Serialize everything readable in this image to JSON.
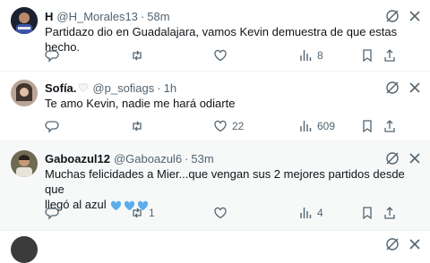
{
  "tweets": [
    {
      "name": "H",
      "handle": "@H_Morales13",
      "time": "58m",
      "text": "Partidazo dio en Guadalajara, vamos Kevin demuestra de que estas hecho.",
      "replies": "",
      "retweets": "",
      "likes": "",
      "views": "8"
    },
    {
      "name": "Sofía.",
      "handle": "@p_sofiags",
      "time": "1h",
      "text": "Te amo Kevin, nadie me hará odiarte",
      "replies": "",
      "retweets": "",
      "likes": "22",
      "views": "609"
    },
    {
      "name": "Gaboazul12",
      "handle": "@Gaboazul6",
      "time": "53m",
      "text_line1": "Muchas felicidades a Mier...que vengan sus 2 mejores partidos desde que",
      "text_line2": "llegó al azul",
      "replies": "",
      "retweets": "1",
      "likes": "",
      "views": "4"
    }
  ],
  "colors": {
    "text": "#0f1419",
    "secondary": "#536471",
    "divider": "#eff3f4",
    "highlight_bg": "#f7f9f9",
    "heart_emoji": "#5dadec"
  }
}
